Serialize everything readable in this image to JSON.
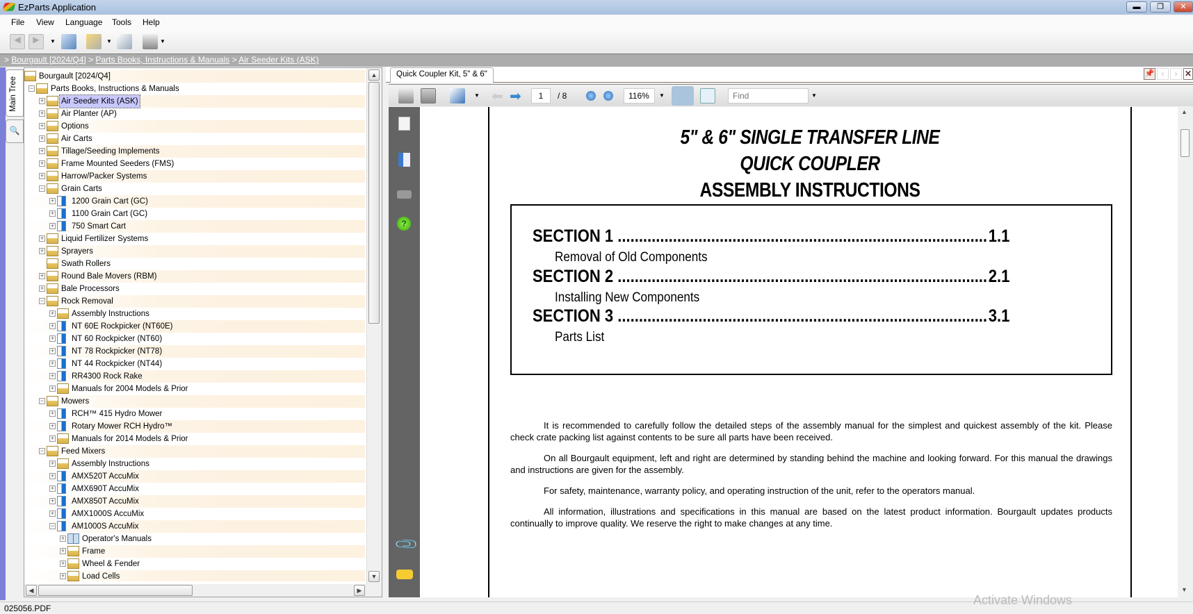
{
  "window": {
    "title": "EzParts Application"
  },
  "menu": [
    "File",
    "View",
    "Language",
    "Tools",
    "Help"
  ],
  "breadcrumb": {
    "sep": ">",
    "items": [
      "Bourgault [2024/Q4]",
      "Parts Books, Instructions & Manuals",
      "Air Seeder Kits (ASK)"
    ]
  },
  "left_tabs": {
    "main_tree": "Main Tree"
  },
  "tree": [
    {
      "label": "Bourgault [2024/Q4]",
      "level": 0,
      "exp": "",
      "icon": "folder"
    },
    {
      "label": "Parts Books, Instructions & Manuals",
      "level": 1,
      "exp": "-",
      "icon": "folder"
    },
    {
      "label": "Air Seeder Kits (ASK)",
      "level": 2,
      "exp": "+",
      "icon": "folder",
      "selected": true
    },
    {
      "label": "Air Planter (AP)",
      "level": 2,
      "exp": "+",
      "icon": "folder"
    },
    {
      "label": "Options",
      "level": 2,
      "exp": "+",
      "icon": "folder"
    },
    {
      "label": "Air Carts",
      "level": 2,
      "exp": "+",
      "icon": "folder"
    },
    {
      "label": "Tillage/Seeding Implements",
      "level": 2,
      "exp": "+",
      "icon": "folder"
    },
    {
      "label": "Frame Mounted Seeders (FMS)",
      "level": 2,
      "exp": "+",
      "icon": "folder"
    },
    {
      "label": "Harrow/Packer Systems",
      "level": 2,
      "exp": "+",
      "icon": "folder"
    },
    {
      "label": "Grain Carts",
      "level": 2,
      "exp": "-",
      "icon": "folder"
    },
    {
      "label": "1200 Grain Cart (GC)",
      "level": 3,
      "exp": "+",
      "icon": "model"
    },
    {
      "label": "1100 Grain Cart (GC)",
      "level": 3,
      "exp": "+",
      "icon": "model"
    },
    {
      "label": "750 Smart Cart",
      "level": 3,
      "exp": "+",
      "icon": "model"
    },
    {
      "label": "Liquid Fertilizer Systems",
      "level": 2,
      "exp": "+",
      "icon": "folder"
    },
    {
      "label": "Sprayers",
      "level": 2,
      "exp": "+",
      "icon": "folder"
    },
    {
      "label": "Swath Rollers",
      "level": 2,
      "exp": "",
      "icon": "folder"
    },
    {
      "label": "Round Bale Movers (RBM)",
      "level": 2,
      "exp": "+",
      "icon": "folder"
    },
    {
      "label": "Bale Processors",
      "level": 2,
      "exp": "+",
      "icon": "folder"
    },
    {
      "label": "Rock Removal",
      "level": 2,
      "exp": "-",
      "icon": "folder"
    },
    {
      "label": "Assembly Instructions",
      "level": 3,
      "exp": "+",
      "icon": "folder"
    },
    {
      "label": "NT 60E Rockpicker (NT60E)",
      "level": 3,
      "exp": "+",
      "icon": "model"
    },
    {
      "label": "NT 60 Rockpicker (NT60)",
      "level": 3,
      "exp": "+",
      "icon": "model"
    },
    {
      "label": "NT 78 Rockpicker (NT78)",
      "level": 3,
      "exp": "+",
      "icon": "model"
    },
    {
      "label": "NT 44 Rockpicker (NT44)",
      "level": 3,
      "exp": "+",
      "icon": "model"
    },
    {
      "label": "RR4300 Rock Rake",
      "level": 3,
      "exp": "+",
      "icon": "model"
    },
    {
      "label": "Manuals for 2004 Models & Prior",
      "level": 3,
      "exp": "+",
      "icon": "folder"
    },
    {
      "label": "Mowers",
      "level": 2,
      "exp": "-",
      "icon": "folder"
    },
    {
      "label": "RCH™ 415 Hydro Mower",
      "level": 3,
      "exp": "+",
      "icon": "model"
    },
    {
      "label": "Rotary Mower RCH Hydro™",
      "level": 3,
      "exp": "+",
      "icon": "model"
    },
    {
      "label": "Manuals for 2014 Models & Prior",
      "level": 3,
      "exp": "+",
      "icon": "folder"
    },
    {
      "label": "Feed Mixers",
      "level": 2,
      "exp": "-",
      "icon": "folder"
    },
    {
      "label": "Assembly Instructions",
      "level": 3,
      "exp": "+",
      "icon": "folder"
    },
    {
      "label": "AMX520T AccuMix",
      "level": 3,
      "exp": "+",
      "icon": "model"
    },
    {
      "label": "AMX690T AccuMix",
      "level": 3,
      "exp": "+",
      "icon": "model"
    },
    {
      "label": "AMX850T AccuMix",
      "level": 3,
      "exp": "+",
      "icon": "model"
    },
    {
      "label": "AMX1000S AccuMix",
      "level": 3,
      "exp": "+",
      "icon": "model"
    },
    {
      "label": "AM1000S AccuMix",
      "level": 3,
      "exp": "-",
      "icon": "model"
    },
    {
      "label": "Operator's Manuals",
      "level": 4,
      "exp": "+",
      "icon": "book"
    },
    {
      "label": "Frame",
      "level": 4,
      "exp": "+",
      "icon": "folder"
    },
    {
      "label": "Wheel & Fender",
      "level": 4,
      "exp": "+",
      "icon": "folder"
    },
    {
      "label": "Load Cells",
      "level": 4,
      "exp": "+",
      "icon": "folder"
    }
  ],
  "doc_tab": {
    "label": "Quick Coupler Kit, 5\" & 6\""
  },
  "pdf_toolbar": {
    "page": "1",
    "total": "/ 8",
    "zoom": "116%",
    "find_placeholder": "Find"
  },
  "document": {
    "title_lines": [
      "5\" & 6\" SINGLE TRANSFER LINE",
      "QUICK COUPLER",
      "ASSEMBLY INSTRUCTIONS"
    ],
    "sections": [
      {
        "name": "SECTION 1",
        "page": "1.1",
        "desc": "Removal of Old Components"
      },
      {
        "name": "SECTION 2",
        "page": "2.1",
        "desc": "Installing New Components"
      },
      {
        "name": "SECTION 3",
        "page": "3.1",
        "desc": "Parts List"
      }
    ],
    "paragraphs": [
      "It is recommended to carefully follow the detailed steps of the assembly manual for the simplest and quickest assembly of the  kit.  Please check crate packing list against contents to be sure all parts have been received.",
      "On all Bourgault equipment, left and right are determined by standing behind the machine and looking forward.  For this manual the drawings and instructions are given for the assembly.",
      "For safety, maintenance, warranty policy, and operating instruction of the unit, refer to the operators manual.",
      "All information, illustrations and specifications in this manual are based on the latest product information.  Bourgault updates products continually to improve quality.  We reserve the right to make changes at any time."
    ]
  },
  "status": {
    "file": "025056.PDF"
  },
  "watermark": "Activate Windows"
}
